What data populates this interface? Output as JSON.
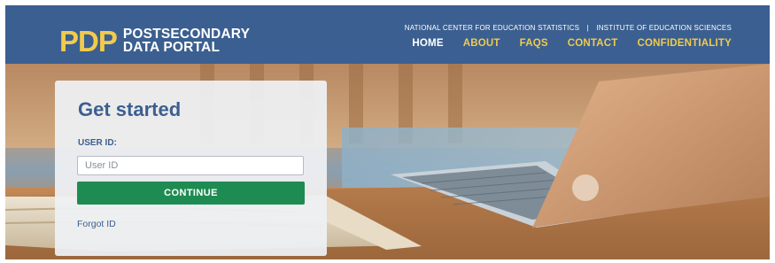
{
  "brand": {
    "mark": "PDP",
    "name_line1": "POSTSECONDARY",
    "name_line2": "DATA PORTAL"
  },
  "agency": {
    "left": "NATIONAL CENTER FOR EDUCATION STATISTICS",
    "separator": "|",
    "right": "INSTITUTE OF EDUCATION SCIENCES"
  },
  "nav": {
    "items": [
      {
        "label": "HOME",
        "active": true
      },
      {
        "label": "ABOUT",
        "active": false
      },
      {
        "label": "FAQS",
        "active": false
      },
      {
        "label": "CONTACT",
        "active": false
      },
      {
        "label": "CONFIDENTIALITY",
        "active": false
      }
    ]
  },
  "login": {
    "title": "Get started",
    "user_id_label": "USER ID:",
    "user_id_placeholder": "User ID",
    "user_id_value": "",
    "continue_label": "CONTINUE",
    "forgot_label": "Forgot ID"
  },
  "colors": {
    "header_bg": "#3b5f90",
    "brand_yellow": "#f2cb4c",
    "button_green": "#1e8c52"
  }
}
